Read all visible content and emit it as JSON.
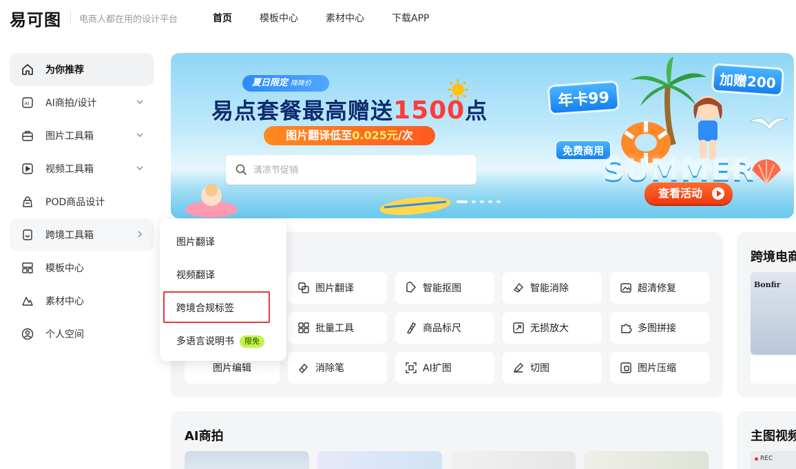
{
  "header": {
    "logo": "易可图",
    "slogan": "电商人都在用的设计平台",
    "nav": [
      {
        "label": "首页",
        "active": true
      },
      {
        "label": "模板中心",
        "active": false
      },
      {
        "label": "素材中心",
        "active": false
      },
      {
        "label": "下载APP",
        "active": false
      }
    ]
  },
  "sidebar": {
    "items": [
      {
        "label": "为你推荐",
        "icon": "home-icon",
        "active": true,
        "arrow": "none"
      },
      {
        "label": "AI商拍/设计",
        "icon": "ai-icon",
        "active": false,
        "arrow": "down"
      },
      {
        "label": "图片工具箱",
        "icon": "toolbox-icon",
        "active": false,
        "arrow": "down"
      },
      {
        "label": "视频工具箱",
        "icon": "video-icon",
        "active": false,
        "arrow": "down"
      },
      {
        "label": "POD商品设计",
        "icon": "bag-icon",
        "active": false,
        "arrow": "none"
      },
      {
        "label": "跨境工具箱",
        "icon": "crossborder-icon",
        "active": false,
        "arrow": "right"
      },
      {
        "label": "模板中心",
        "icon": "template-icon",
        "active": false,
        "arrow": "none"
      },
      {
        "label": "素材中心",
        "icon": "material-icon",
        "active": false,
        "arrow": "none"
      },
      {
        "label": "个人空间",
        "icon": "user-icon",
        "active": false,
        "arrow": "none"
      }
    ]
  },
  "banner": {
    "tag": "夏日限定",
    "tag_small": "降降价",
    "headline_prefix": "易点套餐最高赠送",
    "headline_number": "1500",
    "headline_suffix": "点",
    "sub_prefix": "图片翻译低至",
    "sub_price": "0.025元",
    "sub_suffix": "/次",
    "search_placeholder": "清凉节促销",
    "badge_year": "年卡99",
    "badge_gift": "加赠200",
    "badge_free": "免费商用",
    "summer_text": "SUMMER",
    "cta": "查看活动"
  },
  "flyout": {
    "items": [
      {
        "label": "图片翻译"
      },
      {
        "label": "视频翻译"
      },
      {
        "label": "跨境合规标签",
        "highlighted": true
      },
      {
        "label": "多语言说明书",
        "badge": "限免"
      }
    ]
  },
  "tools": {
    "rows": [
      [
        {
          "label": "图片翻译",
          "icon": "translate-icon"
        },
        {
          "label": "智能抠图",
          "icon": "cutout-icon"
        },
        {
          "label": "智能消除",
          "icon": "eraser-icon"
        },
        {
          "label": "超清修复",
          "icon": "restore-icon"
        }
      ],
      [
        {
          "label": "批量工具",
          "icon": "grid-icon"
        },
        {
          "label": "商品标尺",
          "icon": "ruler-icon"
        },
        {
          "label": "无损放大",
          "icon": "enlarge-icon"
        },
        {
          "label": "多图拼接",
          "icon": "puzzle-icon"
        }
      ],
      [
        {
          "label": "图片编辑",
          "icon": ""
        },
        {
          "label": "消除笔",
          "icon": "brush-eraser-icon"
        },
        {
          "label": "AI扩图",
          "icon": "ai-expand-icon"
        },
        {
          "label": "切图",
          "icon": "pen-icon"
        },
        {
          "label": "图片压缩",
          "icon": "compress-icon"
        }
      ]
    ]
  },
  "right_cards": {
    "crossborder_title": "跨境电商",
    "crossborder_product_label": "Bonfir",
    "video_title": "主图视频",
    "video_rec": "REC"
  },
  "ai_section": {
    "title": "AI商拍"
  }
}
